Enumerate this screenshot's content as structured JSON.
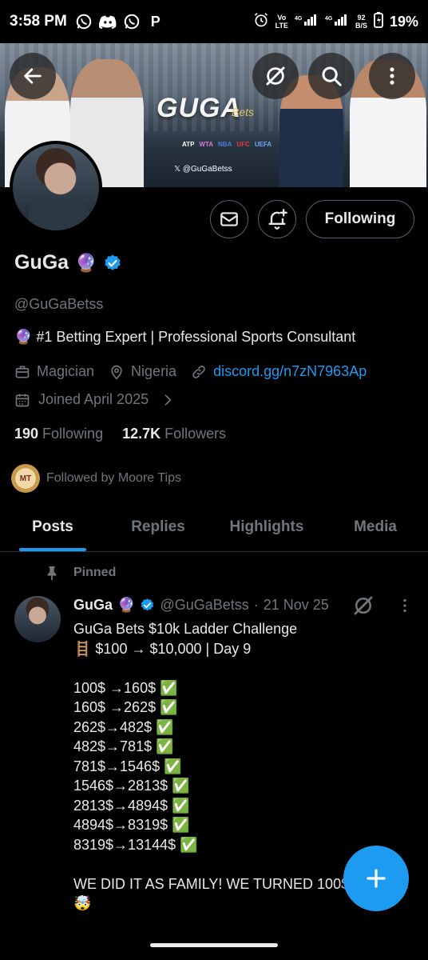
{
  "status_bar": {
    "time": "3:58 PM",
    "apps": [
      "P"
    ],
    "network_top": "Vo",
    "network_bottom": "LTE",
    "net_type": "4G",
    "speed_top": "92",
    "speed_bottom": "B/S",
    "battery": "19%"
  },
  "banner": {
    "logo": "GUGA",
    "logo_sub": "Bets",
    "sponsors": [
      "ATP",
      "WTA",
      "NBA",
      "UFC",
      "UEFA"
    ],
    "x_handle": "𝕏 @GuGaBetss"
  },
  "actions": {
    "follow_label": "Following"
  },
  "profile": {
    "name": "GuGa",
    "name_emoji": "🔮",
    "handle": "@GuGaBetss",
    "bio": "🔮 #1 Betting Expert | Professional Sports Consultant",
    "profession": "Magician",
    "location": "Nigeria",
    "website": "discord.gg/n7zN7963Ap",
    "joined": "Joined April 2025",
    "following_count": "190",
    "following_label": "Following",
    "followers_count": "12.7K",
    "followers_label": "Followers",
    "followed_by": "Followed by Moore Tips",
    "followed_avatar_text": "MT"
  },
  "tabs": [
    {
      "label": "Posts",
      "active": true
    },
    {
      "label": "Replies",
      "active": false
    },
    {
      "label": "Highlights",
      "active": false
    },
    {
      "label": "Media",
      "active": false
    }
  ],
  "post": {
    "pinned_label": "Pinned",
    "author_name": "GuGa",
    "author_emoji": "🔮",
    "author_handle": "@GuGaBetss",
    "separator": "·",
    "date": "21 Nov 25",
    "lines": [
      "GuGa Bets $10k Ladder Challenge",
      "🪜 $100 → $10,000 | Day 9",
      "",
      "100$ →160$ ✅",
      "160$ →262$ ✅",
      "262$→482$ ✅",
      "482$→781$ ✅",
      "781$→1546$ ✅",
      "1546$→2813$ ✅",
      "2813$→4894$ ✅",
      "4894$→8319$ ✅",
      "8319$→13144$ ✅",
      "",
      "WE DID IT AS FAMILY! WE TURNED 100$",
      "🤯"
    ],
    "trailing_text": "!"
  },
  "colors": {
    "accent": "#1d9bf0",
    "background": "#000000",
    "text_primary": "#e7e9ea",
    "text_secondary": "#71767b"
  },
  "icons": {
    "back": "arrow-left-icon",
    "grok": "grok-icon",
    "search": "search-icon",
    "more": "more-vertical-icon",
    "mail": "mail-icon",
    "notify": "bell-plus-icon",
    "compose": "plus-icon"
  }
}
